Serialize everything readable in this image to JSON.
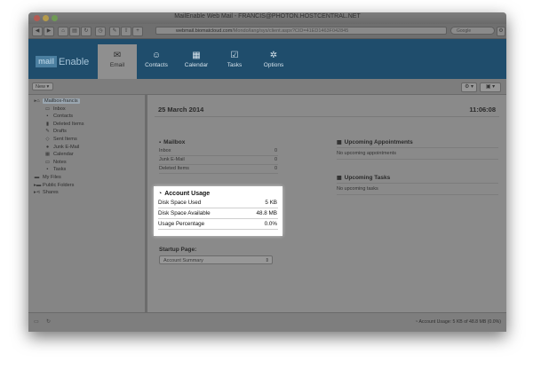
{
  "window": {
    "title": "MailEnable Web Mail - FRANCIS@PHOTON.HOSTCENTRAL.NET",
    "url_domain": "webmail.biomatcloud.com",
    "url_path": "/Mondo/lang/sys/client.aspx?CID=41ED1463F042845",
    "search_placeholder": "Google"
  },
  "app": {
    "logo_mark": "mail",
    "logo_text": "Enable",
    "nav": [
      {
        "label": "Email",
        "icon": "envelope-icon",
        "glyph": "✉",
        "active": true
      },
      {
        "label": "Contacts",
        "icon": "person-icon",
        "glyph": "☺",
        "active": false
      },
      {
        "label": "Calendar",
        "icon": "calendar-icon",
        "glyph": "▦",
        "active": false
      },
      {
        "label": "Tasks",
        "icon": "clipboard-icon",
        "glyph": "☑",
        "active": false
      },
      {
        "label": "Options",
        "icon": "gear-icon",
        "glyph": "✲",
        "active": false
      }
    ]
  },
  "subbar": {
    "new_label": "New ▾",
    "gear_glyph": "⚙ ▾",
    "user_glyph": "▣ ▾"
  },
  "sidebar": {
    "items": [
      {
        "label": "Mailbox-francis",
        "glyph": "▸⌂",
        "indent": 0,
        "selected": true,
        "icon": "home-icon"
      },
      {
        "label": "Inbox",
        "glyph": "▭",
        "indent": 1,
        "icon": "inbox-icon"
      },
      {
        "label": "Contacts",
        "glyph": "▪",
        "indent": 1,
        "icon": "contacts-icon"
      },
      {
        "label": "Deleted Items",
        "glyph": "▮",
        "indent": 1,
        "icon": "trash-icon"
      },
      {
        "label": "Drafts",
        "glyph": "✎",
        "indent": 1,
        "icon": "drafts-icon"
      },
      {
        "label": "Sent Items",
        "glyph": "◇",
        "indent": 1,
        "icon": "sent-icon"
      },
      {
        "label": "Junk E-Mail",
        "glyph": "●",
        "indent": 1,
        "icon": "junk-icon"
      },
      {
        "label": "Calendar",
        "glyph": "▦",
        "indent": 1,
        "icon": "calendar-icon"
      },
      {
        "label": "Notes",
        "glyph": "▭",
        "indent": 1,
        "icon": "notes-icon"
      },
      {
        "label": "Tasks",
        "glyph": "▪",
        "indent": 1,
        "icon": "tasks-icon"
      },
      {
        "label": "My Files",
        "glyph": "▬",
        "indent": 0,
        "icon": "folder-icon"
      },
      {
        "label": "Public Folders",
        "glyph": "▸▬",
        "indent": 0,
        "icon": "public-folders-icon"
      },
      {
        "label": "Shares",
        "glyph": "▸⋖",
        "indent": 0,
        "icon": "shares-icon"
      }
    ]
  },
  "dashboard": {
    "date": "25 March 2014",
    "time": "11:06:08",
    "mailbox": {
      "heading": "Mailbox",
      "rows": [
        {
          "label": "Inbox",
          "value": "0"
        },
        {
          "label": "Junk E-Mail",
          "value": "0"
        },
        {
          "label": "Deleted Items",
          "value": "0"
        }
      ]
    },
    "usage": {
      "heading": "Account Usage",
      "rows": [
        {
          "label": "Disk Space Used",
          "value": "5 KB"
        },
        {
          "label": "Disk Space Available",
          "value": "48.8 MB"
        },
        {
          "label": "Usage Percentage",
          "value": "0.0%"
        }
      ]
    },
    "startup": {
      "heading": "Startup Page:",
      "selected": "Account Summary"
    },
    "appointments": {
      "heading": "Upcoming Appointments",
      "empty": "No upcoming appointments"
    },
    "tasks": {
      "heading": "Upcoming Tasks",
      "empty": "No upcoming tasks"
    }
  },
  "statusbar": {
    "text": "Account Usage: 5 KB of 48.8 MB (0.0%)"
  }
}
